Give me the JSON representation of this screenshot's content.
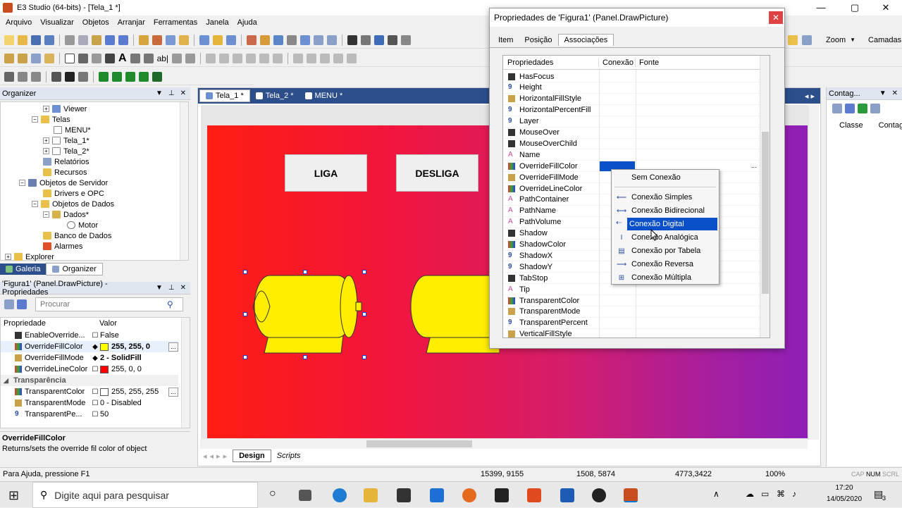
{
  "window": {
    "title": "E3 Studio (64-bits) - [Tela_1 *]",
    "minimize": "—",
    "maximize": "▢",
    "close": "✕"
  },
  "menu": [
    "Arquivo",
    "Visualizar",
    "Objetos",
    "Arranjar",
    "Ferramentas",
    "Janela",
    "Ajuda"
  ],
  "toolbar_right": {
    "zoom": "Zoom",
    "camadas": "Camadas"
  },
  "organizer": {
    "title": "Organizer",
    "tree": [
      {
        "label": "Viewer",
        "exp": "+"
      },
      {
        "label": "Telas",
        "exp": "−"
      },
      {
        "label": "MENU*",
        "exp": ""
      },
      {
        "label": "Tela_1*",
        "exp": "+"
      },
      {
        "label": "Tela_2*",
        "exp": "+"
      },
      {
        "label": "Relatórios",
        "exp": ""
      },
      {
        "label": "Recursos",
        "exp": ""
      },
      {
        "label": "Objetos de Servidor",
        "exp": "−"
      },
      {
        "label": "Drivers e OPC",
        "exp": ""
      },
      {
        "label": "Objetos de Dados",
        "exp": "−"
      },
      {
        "label": "Dados*",
        "exp": "−"
      },
      {
        "label": "Motor",
        "exp": ""
      },
      {
        "label": "Banco de Dados",
        "exp": ""
      },
      {
        "label": "Alarmes",
        "exp": ""
      },
      {
        "label": "Explorer",
        "exp": "+"
      }
    ],
    "tab_galeria": "Galeria",
    "tab_organizer": "Organizer"
  },
  "properties_panel": {
    "title": "'Figura1' (Panel.DrawPicture) - Propriedades",
    "search_placeholder": "Procurar",
    "col_prop": "Propriedade",
    "col_val": "Valor",
    "rows": [
      {
        "name": "EnableOverride...",
        "val": "False",
        "color": ""
      },
      {
        "name": "OverrideFillColor",
        "val": "255, 255, 0",
        "color": "#ffff00"
      },
      {
        "name": "OverrideFillMode",
        "val": "2 - SolidFill",
        "color": ""
      },
      {
        "name": "OverrideLineColor",
        "val": "255, 0, 0",
        "color": "#ff0000"
      },
      {
        "name": "Transparência",
        "val": "",
        "color": ""
      },
      {
        "name": "TransparentColor",
        "val": "255, 255, 255",
        "color": "#ffffff"
      },
      {
        "name": "TransparentMode",
        "val": "0 - Disabled",
        "color": ""
      },
      {
        "name": "TransparentPe...",
        "val": "50",
        "color": ""
      }
    ],
    "desc_title": "OverrideFillColor",
    "desc_text": "Returns/sets the override fil color of object"
  },
  "doc_tabs": [
    "Tela_1 *",
    "Tela_2 *",
    "MENU *"
  ],
  "screen_buttons": {
    "liga": "LIGA",
    "desliga": "DESLIGA"
  },
  "design_tabs": {
    "design": "Design",
    "scripts": "Scripts"
  },
  "right_panel": {
    "title": "Contag...",
    "col1": "Classe",
    "col2": "Contagem"
  },
  "dialog": {
    "title": "Propriedades de 'Figura1' (Panel.DrawPicture)",
    "tabs": [
      "Item",
      "Posição",
      "Associações"
    ],
    "col_prop": "Propriedades",
    "col_con": "Conexão",
    "col_src": "Fonte",
    "rows": [
      "HasFocus",
      "Height",
      "HorizontalFillStyle",
      "HorizontalPercentFill",
      "Layer",
      "MouseOver",
      "MouseOverChild",
      "Name",
      "OverrideFillColor",
      "OverrideFillMode",
      "OverrideLineColor",
      "PathContainer",
      "PathName",
      "PathVolume",
      "Shadow",
      "ShadowColor",
      "ShadowX",
      "ShadowY",
      "TabStop",
      "Tip",
      "TransparentColor",
      "TransparentMode",
      "TransparentPercent",
      "VerticalFillStyle"
    ],
    "close": "✕"
  },
  "context_menu": [
    "Sem Conexão",
    "Conexão Simples",
    "Conexão Bidirecional",
    "Conexão Digital",
    "Conexão Analógica",
    "Conexão por Tabela",
    "Conexão Reversa",
    "Conexão Múltipla"
  ],
  "statusbar": {
    "help": "Para Ajuda, pressione F1",
    "coord1": "15399, 9155",
    "coord2": "1508, 5874",
    "coord3": "4773,3422",
    "zoom": "100%",
    "cap": "CAP",
    "num": "NUM",
    "scrl": "SCRL"
  },
  "taskbar": {
    "search": "Digite aqui para pesquisar",
    "time": "17:20",
    "date": "14/05/2020",
    "notif": "3"
  },
  "colors": {
    "accent": "#0078d7",
    "selection": "#0a50c8",
    "motor": "#ffee00"
  }
}
